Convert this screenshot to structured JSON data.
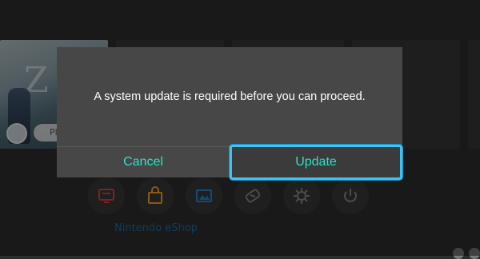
{
  "dialog": {
    "message": "A system update is required before you can proceed.",
    "cancel_label": "Cancel",
    "update_label": "Update"
  },
  "home": {
    "game_tile": {
      "title_fragment": "Z",
      "play_label": "Pl"
    },
    "shortcuts": [
      {
        "icon": "news-icon",
        "color": "#e0413a"
      },
      {
        "icon": "eshop-bag-icon",
        "color": "#f5a623"
      },
      {
        "icon": "album-icon",
        "color": "#1f8ad8"
      },
      {
        "icon": "controllers-icon",
        "color": "#8a8a8a"
      },
      {
        "icon": "settings-gear-icon",
        "color": "#8a8a8a"
      },
      {
        "icon": "power-icon",
        "color": "#8a8a8a"
      }
    ],
    "selected_shortcut_label": "Nintendo eShop"
  },
  "colors": {
    "accent_text": "#2fe0c4",
    "focus_border": "#3fc2ef",
    "dialog_bg": "#474747"
  }
}
